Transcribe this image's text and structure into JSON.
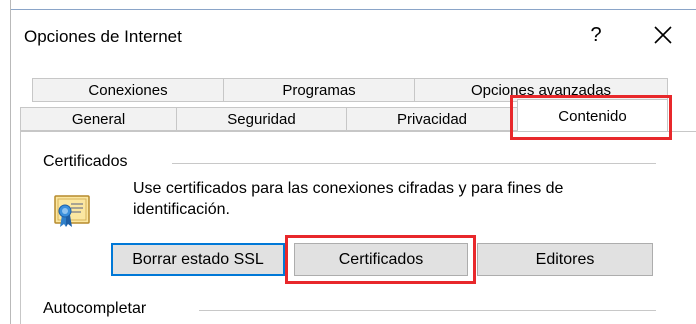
{
  "window": {
    "title": "Opciones de Internet",
    "help_label": "?",
    "close_icon": "close-icon"
  },
  "tabs": {
    "row_top": [
      "Conexiones",
      "Programas",
      "Opciones avanzadas"
    ],
    "row_bottom": [
      "General",
      "Seguridad",
      "Privacidad",
      "Contenido"
    ],
    "active": "Contenido"
  },
  "certificates": {
    "group_label": "Certificados",
    "description_line1": "Use certificados para las conexiones cifradas y para fines de",
    "description_line2": "identificación.",
    "icon": "certificate-icon",
    "buttons": {
      "clear_ssl": "Borrar estado SSL",
      "certificates": "Certificados",
      "publishers": "Editores"
    }
  },
  "autocomplete": {
    "group_label": "Autocompletar"
  },
  "highlight_color": "#e8282b",
  "accent_color": "#0078d7"
}
